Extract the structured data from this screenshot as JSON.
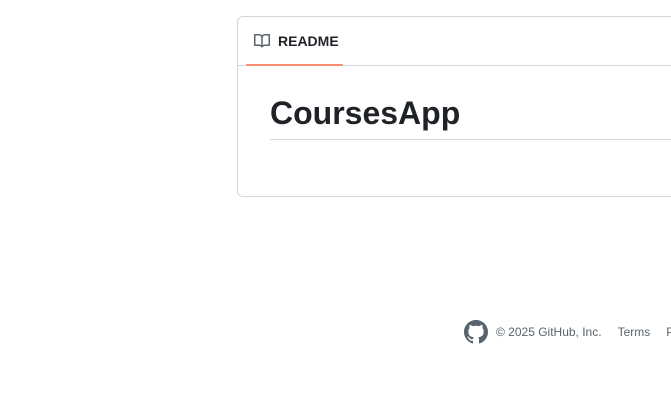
{
  "readme": {
    "tab_label": "README",
    "tab_icon": "book-icon",
    "accent_color": "#fd8c73",
    "heading": "CoursesApp"
  },
  "footer": {
    "logo_icon": "github-logo-icon",
    "copyright": "© 2025 GitHub, Inc.",
    "links": [
      {
        "label": "Terms"
      },
      {
        "label": "P"
      }
    ]
  }
}
